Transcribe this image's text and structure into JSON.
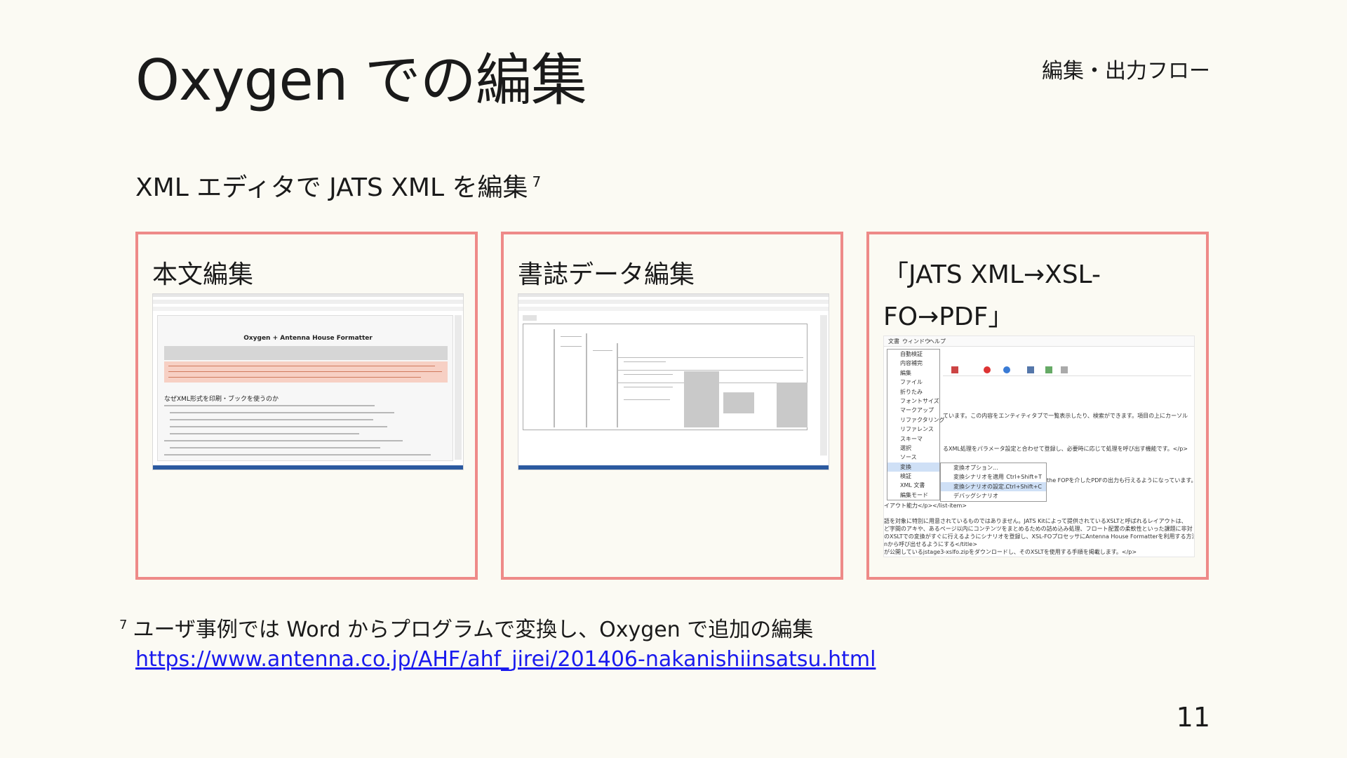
{
  "slide": {
    "title": "Oxygen での編集",
    "section": "編集・出力フロー",
    "subtitle": "XML エディタで JATS XML を編集",
    "subtitle_note_ref": "7",
    "page_number": "11"
  },
  "panels": [
    {
      "heading": "本文編集"
    },
    {
      "heading": "書誌データ編集"
    },
    {
      "heading": "「JATS XML→XSL-FO→PDF」"
    }
  ],
  "screenshot_1": {
    "doc_title": "Oxygen + Antenna House Formatter",
    "body_heading": "なぜXML形式を印刷・ブックを使うのか"
  },
  "screenshot_3": {
    "menubar": [
      "文書",
      "ウィンドウ",
      "ヘルプ"
    ],
    "menu_items": [
      "自動検証",
      "内容補完",
      "編集",
      "ファイル",
      "折りたみ",
      "フォントサイズ",
      "マークアップ",
      "リファクタリング",
      "リファレンス",
      "スキーマ",
      "選択",
      "ソース",
      "変換",
      "検証",
      "XML 文書",
      "編集モード"
    ],
    "menu_selected": "変換",
    "submenu_items": [
      "変換オプション...",
      "変換シナリオを適用",
      "変換シナリオの設定...",
      "デバッグシナリオ"
    ],
    "submenu_shortcuts": [
      "",
      "Ctrl+Shift+T",
      "Ctrl+Shift+C",
      ""
    ],
    "submenu_selected": "変換シナリオの設定...",
    "body_lines": [
      "ています。この内容をエンティティタブで一覧表示したり、検索ができます。項目の上にカーソル",
      "るXML処理をパラメータ設定と合わせて登録し、必要時に応じて処理を呼び出す機能です。</p>",
      "the FOPを介したPDFの出力も行えるようになっています。",
      "イアウト能力</p></list-item>",
      "語を対象に特別に用意されているものではありません。JATS Kitによって提供されているXSLTと呼ばれるレイアウトは、",
      "ど字間のアキや、あるページ以内にコンテンツをまとめるための詰め込み処理、フロート配置の柔軟性といった課題に非対",
      "のXSLTでの変換がすぐに行えるようにシナリオを登録し、XSL-FOプロセッサにAntenna House Formatterを利用する方法を",
      "nから呼び出せるようにする</title>",
      "が公開しているjstage3-xslfo.zipをダウンロードし、そのXSLTを使用する手順を掲載します。</p>"
    ]
  },
  "footnote": {
    "marker": "7",
    "text": "ユーザ事例では Word からプログラムで変換し、Oxygen で追加の編集",
    "url": "https://www.antenna.co.jp/AHF/ahf_jirei/201406-nakanishiinsatsu.html"
  },
  "colors": {
    "background": "#fbfaf3",
    "panel_border": "#ee8a88",
    "link": "#1a1aee",
    "menu_highlight": "#cfe0f6",
    "statusbar": "#2c5aa0"
  }
}
